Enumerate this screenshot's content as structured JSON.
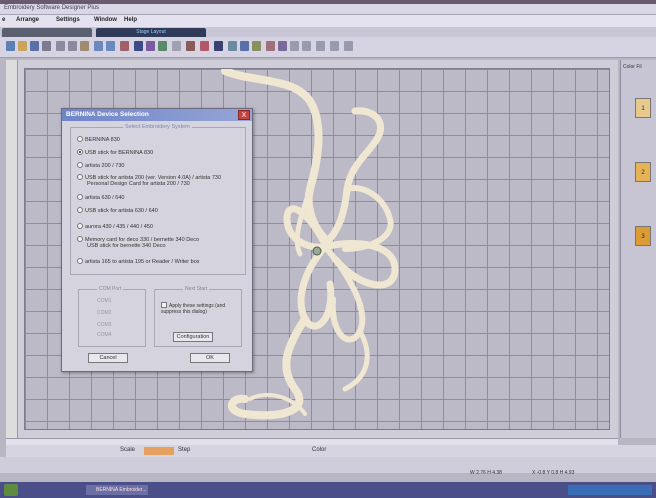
{
  "window": {
    "title": "Embroidery Software Designer Plus"
  },
  "menu": {
    "items": [
      "e",
      "Arrange",
      "Settings",
      "Window",
      "Help"
    ]
  },
  "tabs": [
    "",
    "Stage Layout"
  ],
  "dialog": {
    "title": "BERNINA Device Selection",
    "close_label": "X",
    "group_title": "Select Embroidery System",
    "options": [
      {
        "label": "BERNINA 830",
        "selected": false
      },
      {
        "label": "USB stick for BERNINA 830",
        "selected": true
      },
      {
        "label": "artista 200 / 730",
        "selected": false
      },
      {
        "label": "USB stick for artista 200 (ver. Version 4.0A) / artista 730",
        "line2": "Personal Design Card for artista 200 / 730",
        "selected": false
      },
      {
        "label": "artista 630 / 640",
        "selected": false
      },
      {
        "label": "USB stick for artista 630 / 640",
        "selected": false
      },
      {
        "label": "aurora 430 / 435 / 440 / 450",
        "selected": false
      },
      {
        "label": "Memory card for deco 330 / bernette 340 Deco",
        "line2": "USB stick for bernette 340 Deco",
        "selected": false
      },
      {
        "label": "artista 165 to artista 195 or Reader / Writer box",
        "selected": false
      }
    ],
    "com_port": {
      "title": "COM Port",
      "ports": [
        "COM1",
        "COM2",
        "COM3",
        "COM4"
      ]
    },
    "next_start": {
      "title": "Next Start",
      "checkbox_label": "Apply these settings (and suppress this dialog)",
      "configuration_label": "Configuration"
    },
    "cancel_label": "Cancel",
    "ok_label": "OK"
  },
  "palette": {
    "header": "Color Fil",
    "swatches": [
      "1",
      "2",
      "3"
    ]
  },
  "status": {
    "zoom": "Scale",
    "stitch": "Step",
    "color": "Color"
  },
  "coords": {
    "left": "W 2.76 H 4.38",
    "right": "X -0.8 Y 0.8 H 4.93"
  },
  "taskbar": {
    "task_label": "BERNINA Embroider..."
  }
}
